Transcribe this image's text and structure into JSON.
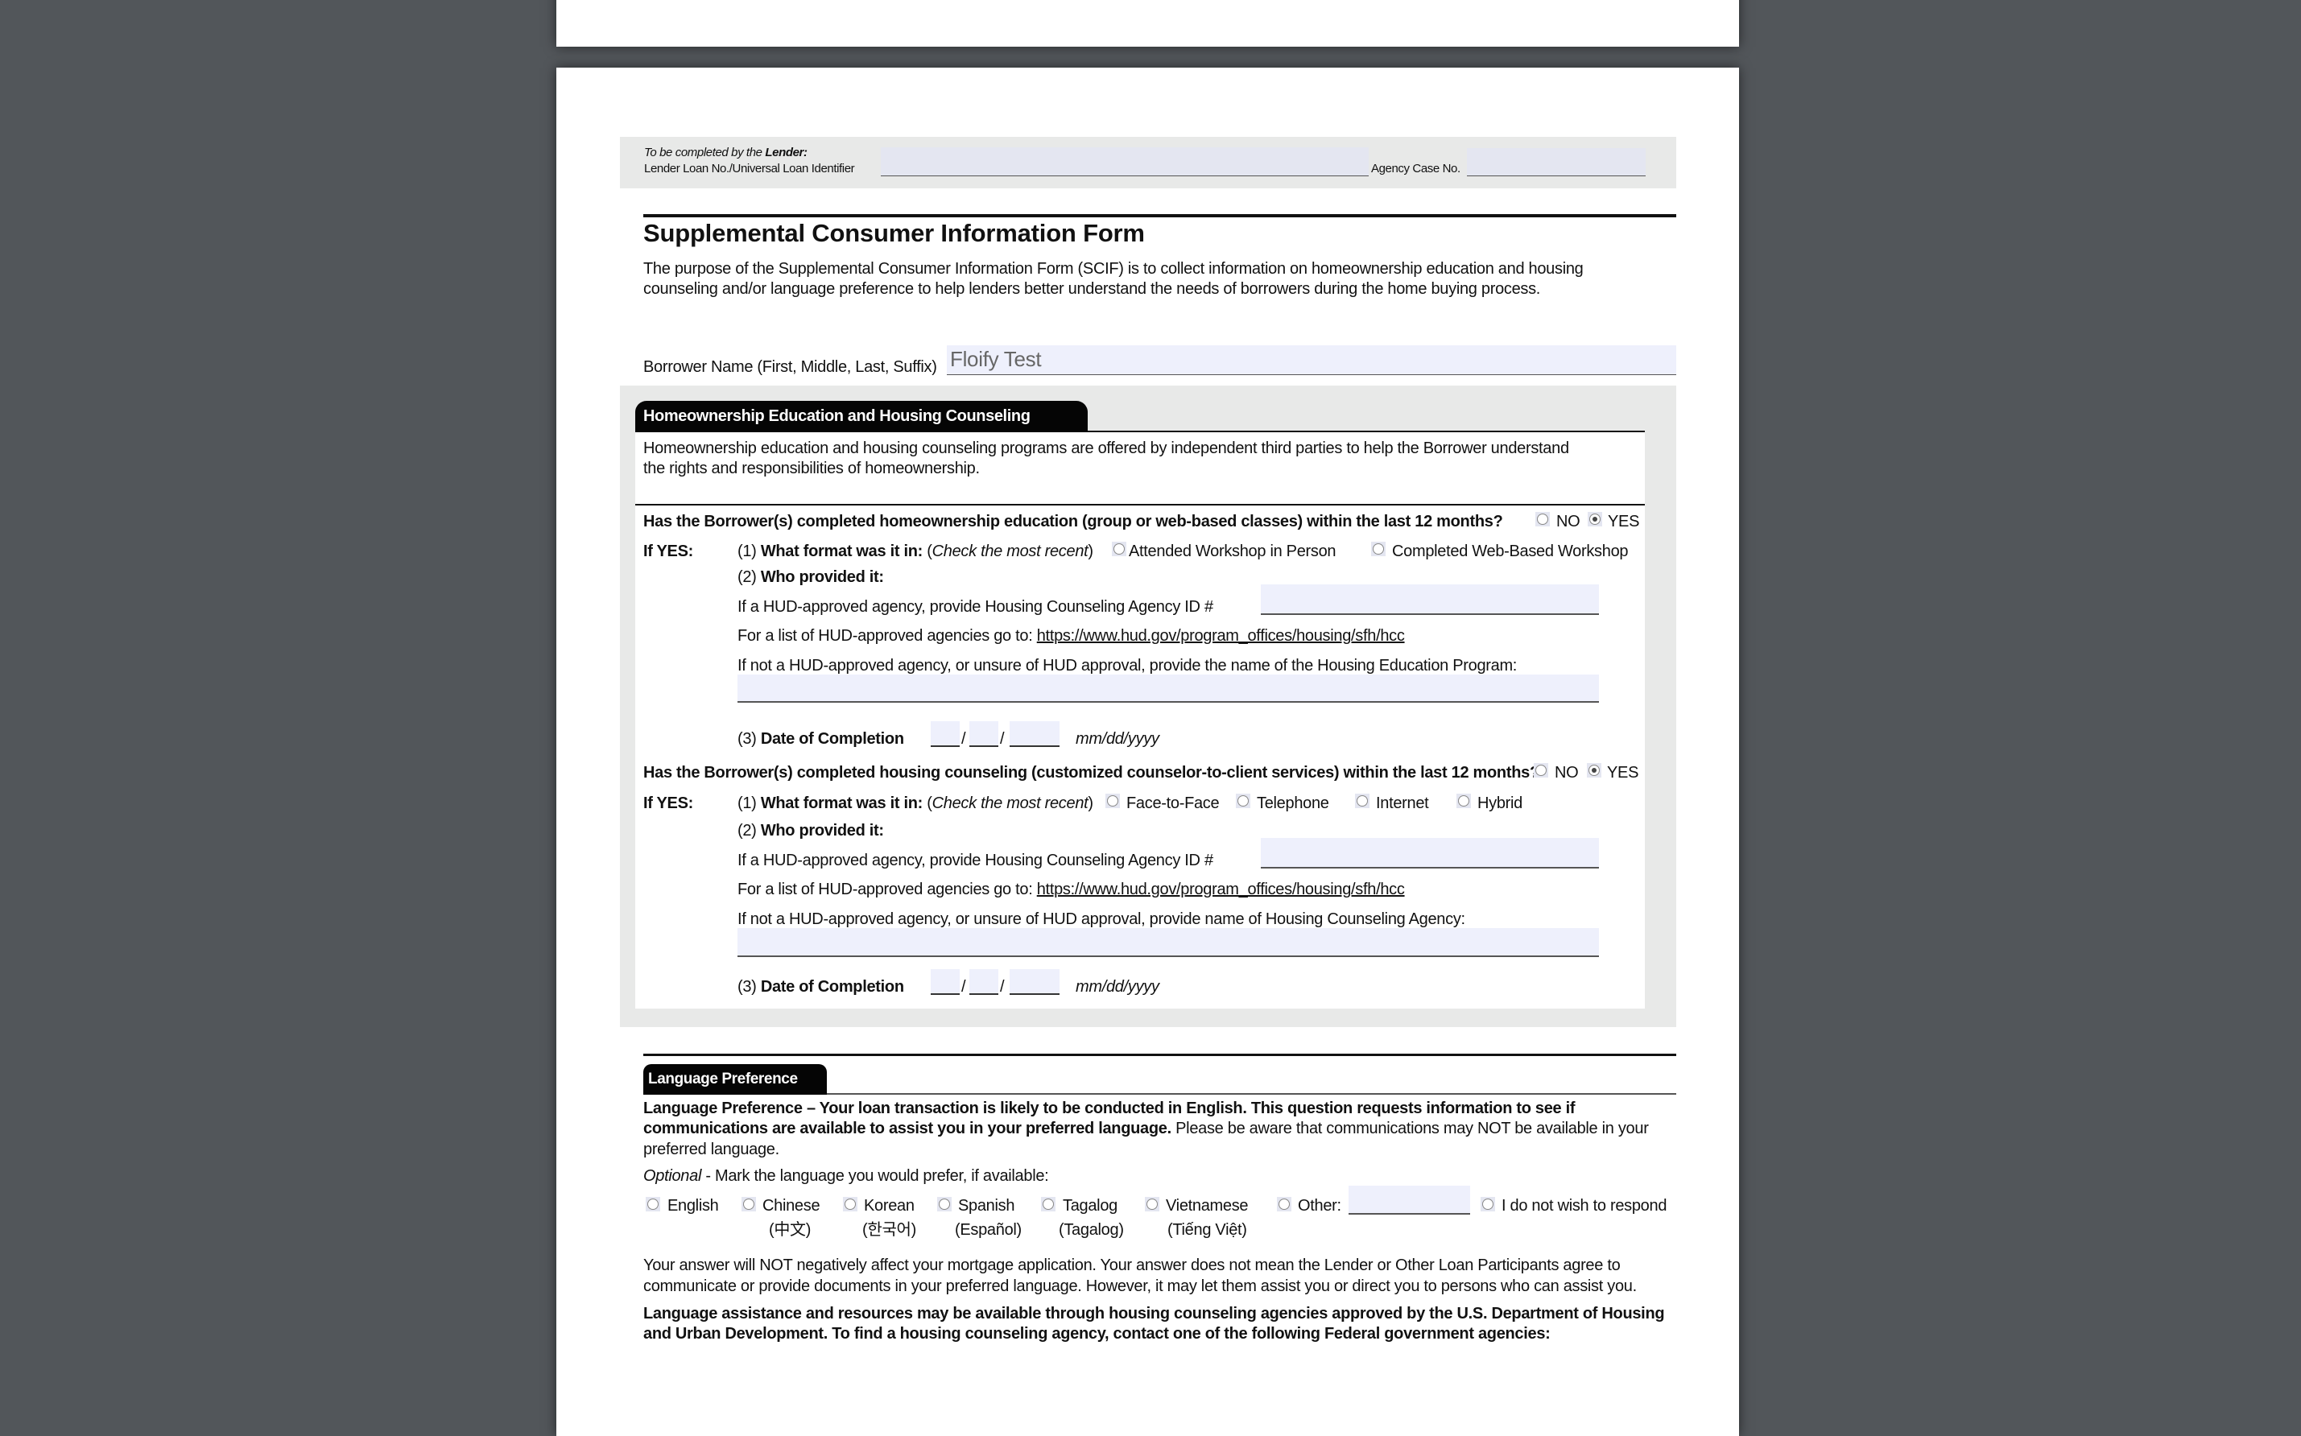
{
  "lender_section": {
    "completed_by_prefix": "To be completed by the ",
    "completed_by_bold": "Lender:",
    "loan_id_label": "Lender Loan No./Universal Loan Identifier",
    "loan_id_value": "",
    "agency_case_label": "Agency Case No.",
    "agency_case_value": ""
  },
  "form": {
    "title": "Supplemental Consumer Information Form",
    "purpose_line1": "The purpose of the Supplemental Consumer Information Form (SCIF) is to collect information on homeownership education and housing",
    "purpose_line2": "counseling and/or language preference to help lenders better understand the needs of borrowers during the home buying process.",
    "borrower_name_label": "Borrower Name (First, Middle, Last, Suffix)",
    "borrower_name_value": "Floify Test"
  },
  "housing_section": {
    "tab_label": "Homeownership Education and Housing Counseling",
    "intro_line1": "Homeownership education and housing counseling programs are offered by independent third parties to help the Borrower understand",
    "intro_line2": "the rights and responsibilities of homeownership.",
    "education": {
      "question": "Has the Borrower(s) completed homeownership education (group or web-based classes) within the last 12 months?",
      "no_label": "NO",
      "yes_label": "YES",
      "selected": "YES",
      "if_yes": "If YES:",
      "format_num": "(1) ",
      "format_label": "What format was it in:",
      "format_hint_open": " (",
      "format_hint": "Check the most recent",
      "format_hint_close": ")",
      "format_options": [
        "Attended Workshop in Person",
        "Completed Web-Based Workshop"
      ],
      "who_num": "(2) ",
      "who_label": "Who provided it:",
      "hud_id_label": "If a HUD-approved agency, provide Housing Counseling Agency ID #",
      "hud_id_value": "",
      "list_label": "For a list of HUD-approved agencies go to: ",
      "list_url": "https://www.hud.gov/program_offices/housing/sfh/hcc",
      "not_hud_label": "If not a HUD-approved agency, or unsure of HUD approval, provide the name of the Housing Education Program:",
      "not_hud_value": "",
      "date_num": "(3) ",
      "date_label": "Date of Completion",
      "date_mm": "",
      "date_dd": "",
      "date_yyyy": "",
      "date_format": "mm/dd/yyyy"
    },
    "counseling": {
      "question": "Has the Borrower(s) completed housing counseling (customized counselor-to-client services) within the last 12 months?",
      "no_label": "NO",
      "yes_label": "YES",
      "selected": "YES",
      "if_yes": "If YES:",
      "format_num": "(1) ",
      "format_label": "What format was it in:",
      "format_hint_open": " (",
      "format_hint": "Check the most recent",
      "format_hint_close": ")",
      "format_options": [
        "Face-to-Face",
        "Telephone",
        "Internet",
        "Hybrid"
      ],
      "who_num": "(2) ",
      "who_label": "Who provided it:",
      "hud_id_label": "If a HUD-approved agency, provide Housing Counseling Agency ID #",
      "hud_id_value": "",
      "list_label": "For a list of HUD-approved agencies go to: ",
      "list_url": "https://www.hud.gov/program_offices/housing/sfh/hcc",
      "not_hud_label": "If not a HUD-approved agency, or unsure of HUD approval, provide name of Housing Counseling Agency:",
      "not_hud_value": "",
      "date_num": "(3) ",
      "date_label": "Date of Completion",
      "date_mm": "",
      "date_dd": "",
      "date_yyyy": "",
      "date_format": "mm/dd/yyyy"
    }
  },
  "language_section": {
    "tab_label": "Language Preference",
    "intro_bold_1": "Language Preference – Your loan transaction is likely to be conducted in English. This question requests information to see if",
    "intro_bold_2": "communications are available to assist you in your preferred language.",
    "intro_normal_2": " Please be aware that communications may NOT be available in your",
    "intro_normal_3": "preferred language.",
    "optional_italic": "Optional",
    "optional_text": " - Mark the language you would prefer, if available:",
    "options": [
      {
        "label": "English",
        "native": ""
      },
      {
        "label": "Chinese",
        "native": "(中文)"
      },
      {
        "label": "Korean",
        "native": "(한국어)"
      },
      {
        "label": "Spanish",
        "native": "(Español)"
      },
      {
        "label": "Tagalog",
        "native": "(Tagalog)"
      },
      {
        "label": "Vietnamese",
        "native": "(Tiếng Việt)"
      },
      {
        "label": "Other:",
        "native": ""
      },
      {
        "label": "I do not wish to respond",
        "native": ""
      }
    ],
    "other_value": "",
    "answer_line1": "Your answer will NOT negatively affect your mortgage application. Your answer does not mean the Lender or Other Loan Participants agree to",
    "answer_line2": "communicate or provide documents in your preferred language. However, it may let them assist you or direct you to persons who can assist you.",
    "assist_line1": "Language assistance and resources may be available through housing counseling agencies approved by the U.S. Department of Housing",
    "assist_line2": "and Urban Development. To find a housing counseling agency, contact one of the following Federal government agencies:"
  }
}
